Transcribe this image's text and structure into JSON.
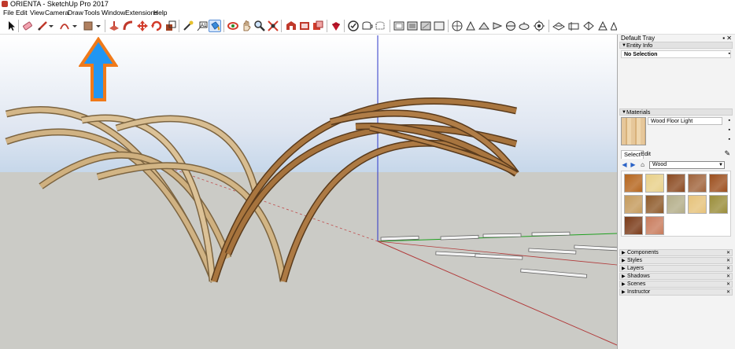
{
  "window": {
    "title": "ORIENTA - SketchUp Pro 2017"
  },
  "menu": {
    "items": [
      "File",
      "Edit",
      "View",
      "Camera",
      "Draw",
      "Tools",
      "Window",
      "Extensions",
      "Help"
    ]
  },
  "toolbar": {
    "tools": [
      "select-tool-icon",
      "eraser-icon",
      "line-tool-icon",
      "arc-tool-icon",
      "rectangle-tool-icon",
      "push-pull-icon",
      "follow-me-icon",
      "move-icon",
      "rotate-icon",
      "scale-icon",
      "tape-measure-icon",
      "text-tool-icon",
      "paint-bucket-icon",
      "orbit-icon",
      "pan-icon",
      "zoom-icon",
      "zoom-extents-icon",
      "warehouse-icon",
      "extension-warehouse-icon",
      "layout-icon",
      "ruby-icon",
      "xray-icon",
      "back-edges-icon",
      "wireframe-icon",
      "hidden-line-icon",
      "shaded-icon",
      "shaded-textures-icon",
      "monochrome-icon",
      "iso-view-icon",
      "top-view-icon",
      "front-view-icon",
      "right-view-icon",
      "back-view-icon",
      "left-view-icon",
      "section-plane-icon",
      "section-display-icon",
      "section-cut-icon",
      "shadows-icon",
      "fog-icon",
      "sandbox-icon"
    ],
    "active_tool": "paint-bucket-icon"
  },
  "annotation": {
    "arrow_color": "#2196f3",
    "arrow_border": "#f07a1a"
  },
  "tray": {
    "title": "Default Tray",
    "buttons": "▪ ✕",
    "entity_info": {
      "header": "Entity Info",
      "value": "No Selection"
    },
    "materials": {
      "header": "Materials",
      "current_material": "Wood Floor Light",
      "tabs": [
        "Select",
        "Edit"
      ],
      "library": "Wood",
      "swatches": [
        "#b5651d",
        "#e8d089",
        "#8b4a21",
        "#a0643c",
        "#9c4f1e",
        "#c49a5c",
        "#8e5a2a",
        "#b3ad88",
        "#e6c27a",
        "#9a8d3a",
        "#7a3a18",
        "#c87b5c"
      ]
    },
    "collapsed_panels": [
      "Components",
      "Styles",
      "Layers",
      "Shadows",
      "Scenes",
      "Instructor"
    ]
  }
}
